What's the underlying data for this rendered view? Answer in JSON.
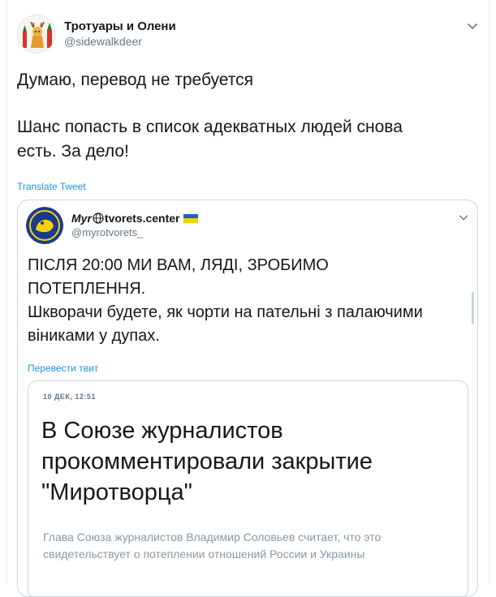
{
  "tweet": {
    "display_name": "Тротуары и Олени",
    "handle": "@sidewalkdeer",
    "line1": "Думаю, перевод не требуется",
    "line2": "Шанс попасть в список адекватных людей снова",
    "line3": "есть. За дело!",
    "translate_label": "Translate Tweet",
    "icons": {
      "menu": "chevron-down-icon"
    }
  },
  "quoted": {
    "display_name_pre": "Myr",
    "display_name_post": "tvorets.center",
    "handle": "@myrotvorets_",
    "line1": "ПІСЛЯ 20:00 МИ ВАМ, ЛЯДІ, ЗРОБИМО",
    "line2": "ПОТЕПЛЕННЯ.",
    "line3": "Шкворачи будете, як чорти на пательні з палаючими",
    "line4": "віниками у дупах.",
    "translate_label": "Перевести твит",
    "flag_colors": {
      "top": "#1d63c8",
      "bottom": "#f4d10b"
    },
    "icons": {
      "globe": "globe-icon",
      "flag": "ukraine-flag-icon",
      "menu": "chevron-down-icon"
    },
    "article": {
      "date": "10 ДЕК, 12:51",
      "headline_1": "В Союзе журналистов",
      "headline_2": "прокомментировали закрытие",
      "headline_3": "\"Миротворца\"",
      "summary_1": "Глава Союза журналистов Владимир Соловьев считает, что это",
      "summary_2": "свидетельствует о потеплении отношений России и Украины"
    }
  },
  "colors": {
    "link": "#1b95e0",
    "text": "#14171a",
    "muted": "#657786",
    "border": "#ccd6dd"
  }
}
